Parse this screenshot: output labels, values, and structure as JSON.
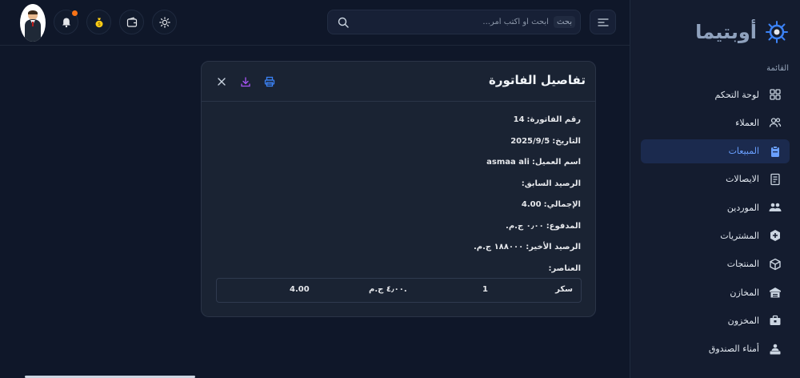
{
  "brand": {
    "name": "أوبتيما"
  },
  "sidebar": {
    "section_label": "القائمة",
    "items": [
      {
        "label": "لوحة التحكم",
        "icon": "grid-icon"
      },
      {
        "label": "العملاء",
        "icon": "users-icon"
      },
      {
        "label": "المبيعات",
        "icon": "clipboard-icon",
        "active": true
      },
      {
        "label": "الايصالات",
        "icon": "receipt-icon"
      },
      {
        "label": "الموردين",
        "icon": "people-group-icon"
      },
      {
        "label": "المشتريات",
        "icon": "shield-box-icon"
      },
      {
        "label": "المنتجات",
        "icon": "cube-icon"
      },
      {
        "label": "المخازن",
        "icon": "warehouse-icon"
      },
      {
        "label": "المخزون",
        "icon": "toolbox-icon"
      },
      {
        "label": "أمناء الصندوق",
        "icon": "cashier-icon"
      }
    ]
  },
  "header": {
    "search": {
      "tag": "بحث",
      "placeholder": "ابحث أو اكتب أمر..."
    }
  },
  "invoice_modal": {
    "title": "تفاصيل الفاتورة",
    "fields": [
      {
        "label": "رقم الفاتورة:",
        "value": "14"
      },
      {
        "label": "التاريخ:",
        "value": "2025/9/5"
      },
      {
        "label": "اسم العميل:",
        "value": "asmaa ali"
      },
      {
        "label": "الرصيد السابق:",
        "value": ""
      },
      {
        "label": "الإجمالي:",
        "value": "4.00"
      },
      {
        "label": "المدفوع:",
        "value": "٠٫٠٠ ج.م."
      },
      {
        "label": "الرصيد الأخير:",
        "value": "١٨٨٠٠٠ ج.م."
      },
      {
        "label": "العناصر:",
        "value": ""
      }
    ],
    "items": [
      {
        "name": "سكر",
        "qty": "1",
        "price": "٤٫٠٠ ج.م.",
        "total": "4.00"
      }
    ]
  },
  "colors": {
    "accent": "#6aa0ff",
    "active_bg": "#1b2a4e",
    "print": "#3b82f6",
    "download": "#a855f7"
  }
}
